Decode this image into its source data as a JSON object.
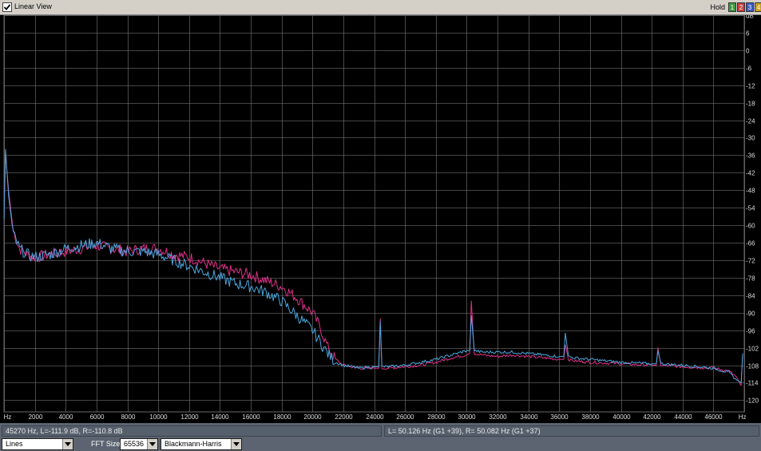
{
  "window": {
    "title": "Linear View",
    "hold_label": "Hold",
    "hold_buttons": [
      {
        "label": "1",
        "color": "#3c9a3c"
      },
      {
        "label": "2",
        "color": "#c84040"
      },
      {
        "label": "3",
        "color": "#3c5ac8"
      },
      {
        "label": "4",
        "color": "#c8a020"
      }
    ]
  },
  "chart_data": {
    "type": "line",
    "x_unit": "Hz",
    "y_unit": "dB",
    "xlim": [
      0,
      48000
    ],
    "ylim": [
      -124,
      12
    ],
    "x_ticks": [
      {
        "v": 0,
        "label": "Hz"
      },
      {
        "v": 2000,
        "label": "2000"
      },
      {
        "v": 4000,
        "label": "4000"
      },
      {
        "v": 6000,
        "label": "6000"
      },
      {
        "v": 8000,
        "label": "8000"
      },
      {
        "v": 10000,
        "label": "10000"
      },
      {
        "v": 12000,
        "label": "12000"
      },
      {
        "v": 14000,
        "label": "14000"
      },
      {
        "v": 16000,
        "label": "16000"
      },
      {
        "v": 18000,
        "label": "18000"
      },
      {
        "v": 20000,
        "label": "20000"
      },
      {
        "v": 22000,
        "label": "22000"
      },
      {
        "v": 24000,
        "label": "24000"
      },
      {
        "v": 26000,
        "label": "26000"
      },
      {
        "v": 28000,
        "label": "28000"
      },
      {
        "v": 30000,
        "label": "30000"
      },
      {
        "v": 32000,
        "label": "32000"
      },
      {
        "v": 34000,
        "label": "34000"
      },
      {
        "v": 36000,
        "label": "36000"
      },
      {
        "v": 38000,
        "label": "38000"
      },
      {
        "v": 40000,
        "label": "40000"
      },
      {
        "v": 42000,
        "label": "42000"
      },
      {
        "v": 44000,
        "label": "44000"
      },
      {
        "v": 46000,
        "label": "46000"
      },
      {
        "v": 48000,
        "label": "Hz"
      }
    ],
    "y_ticks": [
      {
        "v": 12,
        "label": "dB"
      },
      {
        "v": 6,
        "label": "6"
      },
      {
        "v": 0,
        "label": "0"
      },
      {
        "v": -6,
        "label": "-6"
      },
      {
        "v": -12,
        "label": "-12"
      },
      {
        "v": -18,
        "label": "-18"
      },
      {
        "v": -24,
        "label": "-24"
      },
      {
        "v": -30,
        "label": "-30"
      },
      {
        "v": -36,
        "label": "-36"
      },
      {
        "v": -42,
        "label": "-42"
      },
      {
        "v": -48,
        "label": "-48"
      },
      {
        "v": -54,
        "label": "-54"
      },
      {
        "v": -60,
        "label": "-60"
      },
      {
        "v": -66,
        "label": "-66"
      },
      {
        "v": -72,
        "label": "-72"
      },
      {
        "v": -78,
        "label": "-78"
      },
      {
        "v": -84,
        "label": "-84"
      },
      {
        "v": -90,
        "label": "-90"
      },
      {
        "v": -96,
        "label": "-96"
      },
      {
        "v": -102,
        "label": "-102"
      },
      {
        "v": -108,
        "label": "-108"
      },
      {
        "v": -114,
        "label": "-114"
      },
      {
        "v": -120,
        "label": "-120"
      }
    ],
    "grid": true,
    "series": [
      {
        "color": "#e0308a",
        "x": [
          0,
          100,
          300,
          600,
          1000,
          1500,
          2000,
          3000,
          4000,
          5000,
          6000,
          7000,
          8000,
          9000,
          10000,
          11000,
          12000,
          13000,
          14000,
          15000,
          16000,
          17000,
          18000,
          19000,
          20000,
          20500,
          21000,
          21500,
          22000,
          23000,
          24000,
          24300,
          24400,
          24500,
          25000,
          26000,
          27000,
          28000,
          29000,
          30000,
          30200,
          30300,
          30500,
          31000,
          32000,
          33000,
          34000,
          35000,
          36000,
          36300,
          36400,
          36600,
          37000,
          38000,
          40000,
          42000,
          42300,
          42400,
          42600,
          44000,
          46000,
          47000,
          47500,
          47800,
          47900
        ],
        "y": [
          -55,
          -36,
          -48,
          -62,
          -68,
          -70,
          -71,
          -70,
          -69,
          -68,
          -67,
          -68,
          -69,
          -68,
          -68,
          -70,
          -71,
          -73,
          -75,
          -76,
          -77,
          -79,
          -81,
          -85,
          -90,
          -95,
          -102,
          -106,
          -108,
          -109,
          -109,
          -109,
          -92,
          -109,
          -109,
          -108.5,
          -108,
          -107,
          -105.5,
          -104.5,
          -104,
          -86,
          -104,
          -104.5,
          -105,
          -104.5,
          -105,
          -105.5,
          -106,
          -106,
          -101,
          -106,
          -106.5,
          -107,
          -107.5,
          -108,
          -108,
          -102,
          -108,
          -108.5,
          -109,
          -110,
          -112,
          -115,
          -104
        ]
      },
      {
        "color": "#4aa8e0",
        "x": [
          0,
          100,
          300,
          600,
          1000,
          1500,
          2000,
          3000,
          4000,
          5000,
          6000,
          7000,
          8000,
          9000,
          10000,
          11000,
          12000,
          13000,
          14000,
          15000,
          16000,
          17000,
          18000,
          19000,
          20000,
          20500,
          21000,
          21500,
          22000,
          23000,
          24000,
          24300,
          24400,
          24500,
          25000,
          26000,
          27000,
          28000,
          29000,
          30000,
          30200,
          30300,
          30500,
          31000,
          32000,
          33000,
          34000,
          35000,
          36000,
          36300,
          36400,
          36600,
          37000,
          38000,
          40000,
          42000,
          42300,
          42400,
          42600,
          44000,
          46000,
          47000,
          47500,
          47800,
          47900
        ],
        "y": [
          -58,
          -34,
          -50,
          -63,
          -68,
          -70,
          -71,
          -70,
          -68,
          -67,
          -66,
          -68,
          -69,
          -69,
          -70,
          -72,
          -74,
          -76,
          -78,
          -80,
          -81,
          -83,
          -86,
          -91,
          -96,
          -100,
          -104,
          -107,
          -108,
          -109,
          -108.5,
          -108.5,
          -93,
          -108.5,
          -108.5,
          -108,
          -107,
          -106,
          -104.5,
          -103,
          -103,
          -91,
          -103,
          -103.5,
          -103.5,
          -103.5,
          -104,
          -104.5,
          -105,
          -105,
          -97,
          -105,
          -105.5,
          -106,
          -107,
          -107.5,
          -107.5,
          -103,
          -107.5,
          -108,
          -109,
          -110.5,
          -113,
          -114,
          -104
        ]
      }
    ]
  },
  "status": {
    "cursor_readout": "45270 Hz, L=-111.9 dB, R=-110.8 dB",
    "peak_readout": "L= 50.126 Hz (G1 +39), R= 50.082 Hz (G1 +37)"
  },
  "controls": {
    "display_mode": "Lines",
    "fft_size_label": "FFT Size",
    "fft_size": "65536",
    "window_function": "Blackmann-Harris"
  }
}
